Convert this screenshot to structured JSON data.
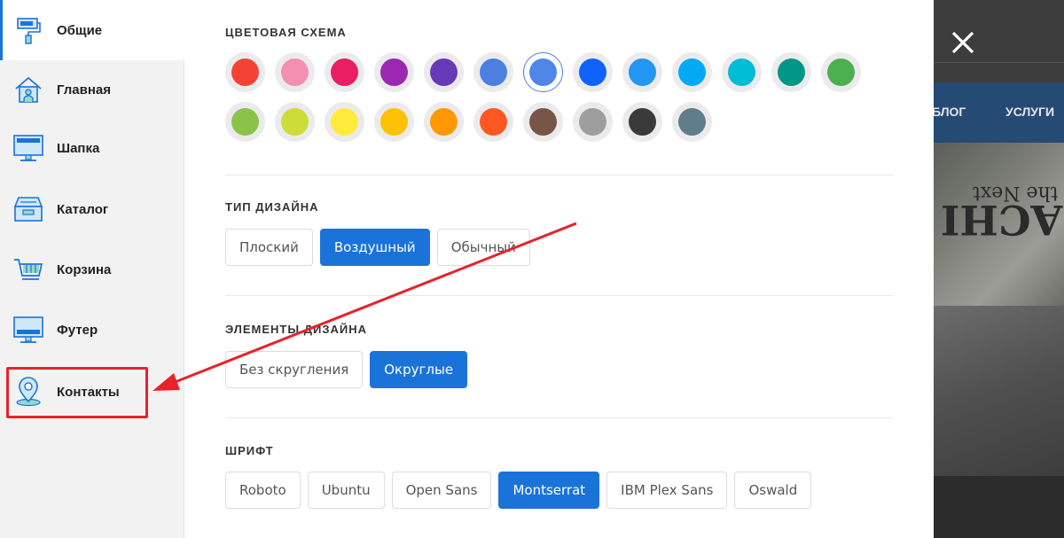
{
  "sidebar": {
    "items": [
      {
        "label": "Общие",
        "icon": "paint-roller-icon",
        "active": true
      },
      {
        "label": "Главная",
        "icon": "home-icon",
        "active": false
      },
      {
        "label": "Шапка",
        "icon": "monitor-icon",
        "active": false
      },
      {
        "label": "Каталог",
        "icon": "catalog-box-icon",
        "active": false
      },
      {
        "label": "Корзина",
        "icon": "cart-icon",
        "active": false
      },
      {
        "label": "Футер",
        "icon": "monitor-icon",
        "active": false
      },
      {
        "label": "Контакты",
        "icon": "location-pin-icon",
        "active": false
      }
    ]
  },
  "color_scheme": {
    "title": "ЦВЕТОВАЯ СХЕМА",
    "colors_row1": [
      "#f44336",
      "#f48fb1",
      "#e91e63",
      "#9c27b0",
      "#673ab7",
      "#4c7fe0",
      "#4f86e8",
      "#0f62fe",
      "#2196f3",
      "#03a9f4",
      "#00bcd4",
      "#009688",
      "#4caf50"
    ],
    "colors_row2": [
      "#8bc34a",
      "#cddc39",
      "#ffeb3b",
      "#ffc107",
      "#ff9800",
      "#ff5722",
      "#795548",
      "#9e9e9e",
      "#3a3a3a",
      "#607d8b"
    ],
    "selected": "#4f86e8"
  },
  "design_type": {
    "title": "ТИП ДИЗАЙНА",
    "options": [
      "Плоский",
      "Воздушный",
      "Обычный"
    ],
    "active": "Воздушный"
  },
  "design_elements": {
    "title": "ЭЛЕМЕНТЫ ДИЗАЙНА",
    "options": [
      "Без скругления",
      "Округлые"
    ],
    "active": "Округлые"
  },
  "font": {
    "title": "ШРИФТ",
    "options": [
      "Roboto",
      "Ubuntu",
      "Open Sans",
      "Montserrat",
      "IBM Plex Sans",
      "Oswald"
    ],
    "active": "Montserrat"
  },
  "site_preview": {
    "nav_items": [
      "БЛОГ",
      "УСЛУГИ"
    ],
    "hero_text_1": "ACHI",
    "hero_text_2": "the Next"
  },
  "colors": {
    "accent": "#1a73d9",
    "annotation": "#e8222a"
  }
}
